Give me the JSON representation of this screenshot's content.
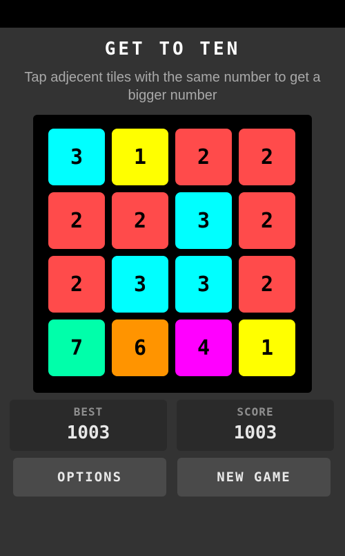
{
  "header": {
    "title": "GET TO TEN",
    "subtitle": "Tap adjecent tiles with the same number to get a bigger number"
  },
  "board": {
    "tiles": [
      [
        {
          "value": "3",
          "color": "#00ffff"
        },
        {
          "value": "1",
          "color": "#ffff00"
        },
        {
          "value": "2",
          "color": "#ff4b4b"
        },
        {
          "value": "2",
          "color": "#ff4b4b"
        }
      ],
      [
        {
          "value": "2",
          "color": "#ff4b4b"
        },
        {
          "value": "2",
          "color": "#ff4b4b"
        },
        {
          "value": "3",
          "color": "#00ffff"
        },
        {
          "value": "2",
          "color": "#ff4b4b"
        }
      ],
      [
        {
          "value": "2",
          "color": "#ff4b4b"
        },
        {
          "value": "3",
          "color": "#00ffff"
        },
        {
          "value": "3",
          "color": "#00ffff"
        },
        {
          "value": "2",
          "color": "#ff4b4b"
        }
      ],
      [
        {
          "value": "7",
          "color": "#00ffaa"
        },
        {
          "value": "6",
          "color": "#ff9400"
        },
        {
          "value": "4",
          "color": "#ff00ff"
        },
        {
          "value": "1",
          "color": "#ffff00"
        }
      ]
    ]
  },
  "stats": {
    "best_label": "BEST",
    "best_value": "1003",
    "score_label": "SCORE",
    "score_value": "1003"
  },
  "buttons": {
    "options": "OPTIONS",
    "new_game": "NEW GAME"
  }
}
